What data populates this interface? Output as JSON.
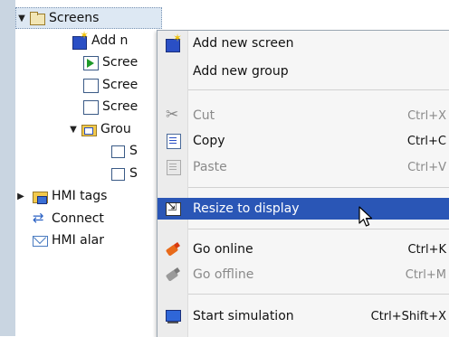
{
  "tree": {
    "screens_folder": "Screens",
    "items": [
      {
        "label": "Add n",
        "icon": "add-screen-icon"
      },
      {
        "label": "Scree",
        "icon": "start-screen-icon"
      },
      {
        "label": "Scree",
        "icon": "screen-icon"
      },
      {
        "label": "Scree",
        "icon": "screen-icon"
      },
      {
        "label": "Grou",
        "icon": "group-folder-icon"
      },
      {
        "label": "S",
        "icon": "screen-icon"
      },
      {
        "label": "S",
        "icon": "screen-icon"
      },
      {
        "label": "HMI tags",
        "icon": "hmi-tags-icon"
      },
      {
        "label": "Connect",
        "icon": "connections-icon"
      },
      {
        "label": "HMI alar",
        "icon": "alarm-icon"
      }
    ]
  },
  "menu": {
    "add_new_screen": "Add new screen",
    "add_new_group": "Add new group",
    "cut": "Cut",
    "cut_shortcut": "Ctrl+X",
    "copy": "Copy",
    "copy_shortcut": "Ctrl+C",
    "paste": "Paste",
    "paste_shortcut": "Ctrl+V",
    "resize_to_display": "Resize to display",
    "go_online": "Go online",
    "go_online_shortcut": "Ctrl+K",
    "go_offline": "Go offline",
    "go_offline_shortcut": "Ctrl+M",
    "start_simulation": "Start simulation",
    "start_simulation_shortcut": "Ctrl+Shift+X"
  },
  "colors": {
    "highlight": "#2a56b6",
    "left_gutter": "#c9d5e1"
  }
}
